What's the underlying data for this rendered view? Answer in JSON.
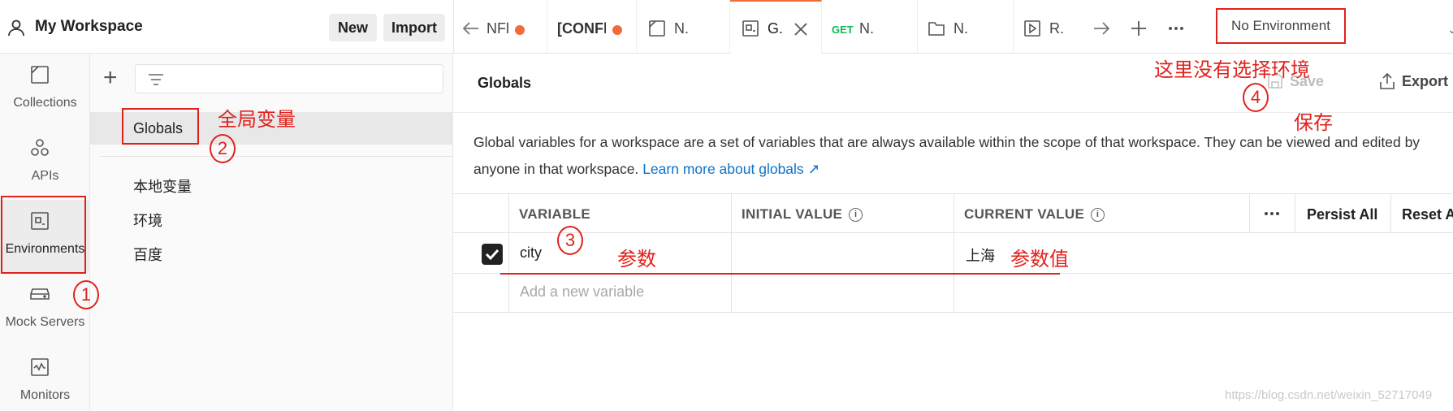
{
  "workspace": {
    "title": "My Workspace",
    "new_label": "New",
    "import_label": "Import"
  },
  "tabs": [
    {
      "label": "NFl",
      "unsaved": true
    },
    {
      "label": "[CONFl",
      "unsaved": true
    },
    {
      "label": "N."
    },
    {
      "label": "G.",
      "active": true
    },
    {
      "method": "GET",
      "label": "N."
    },
    {
      "label": "N."
    },
    {
      "label": "R."
    }
  ],
  "environment": {
    "selected": "No Environment"
  },
  "rail": [
    {
      "label": "Collections"
    },
    {
      "label": "APIs"
    },
    {
      "label": "Environments",
      "active": true
    },
    {
      "label": "Mock Servers"
    },
    {
      "label": "Monitors"
    }
  ],
  "sidebar": {
    "globals_label": "Globals",
    "environments": [
      "本地变量",
      "环境",
      "百度"
    ]
  },
  "main": {
    "title": "Globals",
    "save_label": "Save",
    "export_label": "Export",
    "description": "Global variables for a workspace are a set of variables that are always available within the scope of that workspace. They can be viewed and edited by anyone in that workspace.",
    "learn_more": "Learn more about globals ↗"
  },
  "table": {
    "headers": {
      "variable": "VARIABLE",
      "initial": "INITIAL VALUE",
      "current": "CURRENT VALUE",
      "persist_all": "Persist All",
      "reset_all": "Reset All"
    },
    "rows": [
      {
        "variable": "city",
        "initial": "",
        "current": "上海",
        "enabled": true
      }
    ],
    "add_placeholder": "Add a new variable"
  },
  "annotations": {
    "globals": "全局变量",
    "no_env": "这里没有选择环境",
    "save": "保存",
    "param": "参数",
    "param_value": "参数值",
    "n1": "1",
    "n2": "2",
    "n3": "3",
    "n4": "4"
  },
  "watermark": "https://blog.csdn.net/weixin_52717049",
  "colors": {
    "accent": "#f26b3a",
    "annotation": "#e0221d",
    "link": "#0d72c9"
  }
}
